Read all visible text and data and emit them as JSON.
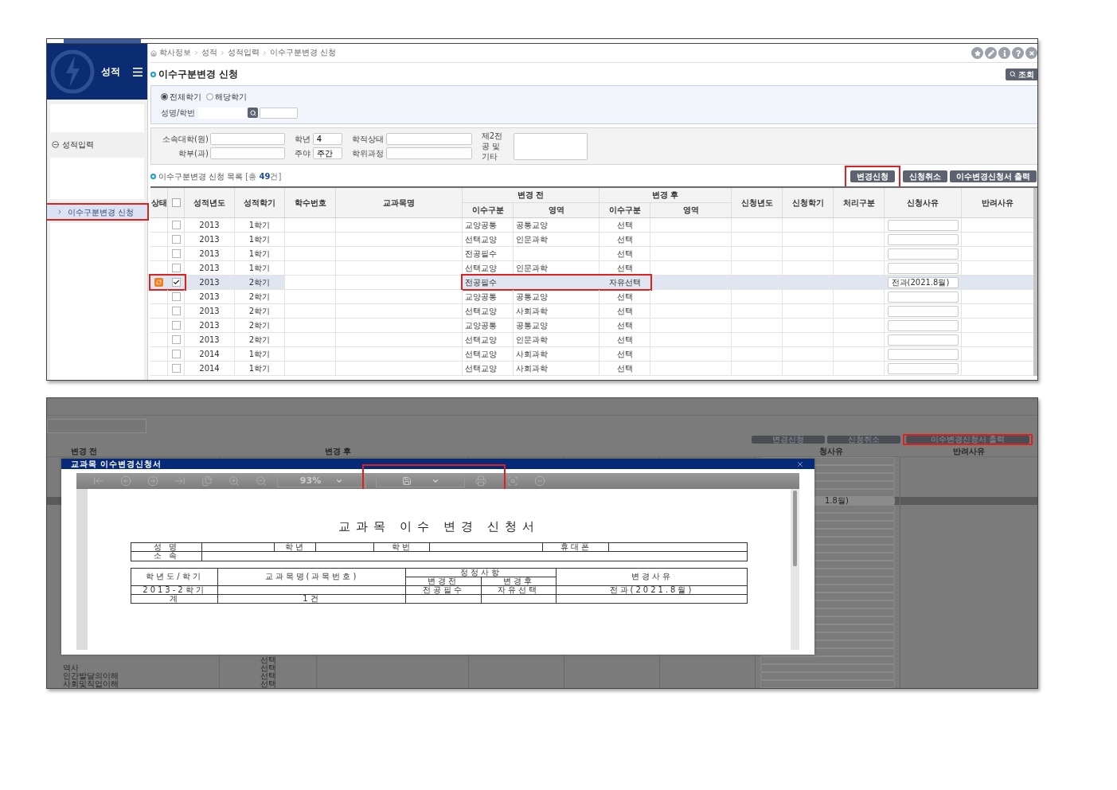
{
  "top_screen": {
    "sidebar": {
      "title": "성적",
      "groups": [
        {
          "label": "성적입력",
          "expanded": true
        }
      ],
      "items": [
        {
          "label": "이수구분변경 신청",
          "selected": true,
          "highlighted": true
        }
      ]
    },
    "breadcrumb": [
      "학사정보",
      "성적",
      "성적입력",
      "이수구분변경 신청"
    ],
    "page_title": "이수구분변경 신청",
    "query_button": "조회",
    "search": {
      "radios": [
        {
          "label": "전체학기",
          "selected": true
        },
        {
          "label": "해당학기",
          "selected": false
        }
      ],
      "name_label": "성명/학번"
    },
    "filters": {
      "college_label": "소속대학(원)",
      "dept_label": "학부(과)",
      "grade_label": "학년",
      "grade_value": "4",
      "shift_label": "주야",
      "shift_value": "주간",
      "status_label": "학적상태",
      "degree_label": "학위과정",
      "second_major_label": "제2전공 및 기타"
    },
    "list": {
      "title": "이수구분변경 신청 목록",
      "count_text": "[총 **49**건]"
    },
    "buttons": [
      {
        "label": "변경신청",
        "highlighted": true
      },
      {
        "label": "신청취소",
        "highlighted": false
      },
      {
        "label": "이수변경신청서 출력",
        "highlighted": false
      }
    ],
    "table": {
      "header": {
        "status": "상태",
        "all_checked": false,
        "year": "성적년도",
        "term": "성적학기",
        "code": "학수번호",
        "course": "교과목명",
        "before": {
          "label": "변경 전",
          "type": "이수구분",
          "area": "영역"
        },
        "after": {
          "label": "변경 후",
          "type": "이수구분",
          "area": "영역"
        },
        "apply_year": "신청년도",
        "apply_term": "신청학기",
        "process": "처리구분",
        "reason": "신청사유",
        "reject": "반려사유"
      },
      "rows": [
        {
          "year": "2013",
          "term": "1학기",
          "before_type": "교양공통",
          "before_area": "공통교양",
          "after_type": "선택",
          "checked": false,
          "selected": false,
          "flagged": false,
          "highlighted": false
        },
        {
          "year": "2013",
          "term": "1학기",
          "before_type": "선택교양",
          "before_area": "인문과학",
          "after_type": "선택",
          "checked": false,
          "selected": false,
          "flagged": false,
          "highlighted": false
        },
        {
          "year": "2013",
          "term": "1학기",
          "before_type": "전공필수",
          "after_type": "선택",
          "checked": false,
          "selected": false,
          "flagged": false,
          "highlighted": false
        },
        {
          "year": "2013",
          "term": "1학기",
          "before_type": "선택교양",
          "before_area": "인문과학",
          "after_type": "선택",
          "checked": false,
          "selected": false,
          "flagged": false,
          "highlighted": false
        },
        {
          "year": "2013",
          "term": "2학기",
          "before_type": "전공필수",
          "after_type": "자유선택",
          "reason": "전과(2021.8월)",
          "checked": true,
          "selected": true,
          "flagged": true,
          "highlighted": true
        },
        {
          "year": "2013",
          "term": "2학기",
          "before_type": "교양공통",
          "before_area": "공통교양",
          "after_type": "선택",
          "checked": false,
          "selected": false,
          "flagged": false,
          "highlighted": false
        },
        {
          "year": "2013",
          "term": "2학기",
          "before_type": "선택교양",
          "before_area": "사회과학",
          "after_type": "선택",
          "checked": false,
          "selected": false,
          "flagged": false,
          "highlighted": false
        },
        {
          "year": "2013",
          "term": "2학기",
          "before_type": "교양공통",
          "before_area": "공통교양",
          "after_type": "선택",
          "checked": false,
          "selected": false,
          "flagged": false,
          "highlighted": false
        },
        {
          "year": "2013",
          "term": "2학기",
          "before_type": "선택교양",
          "before_area": "인문과학",
          "after_type": "선택",
          "checked": false,
          "selected": false,
          "flagged": false,
          "highlighted": false
        },
        {
          "year": "2014",
          "term": "1학기",
          "before_type": "선택교양",
          "before_area": "사회과학",
          "after_type": "선택",
          "checked": false,
          "selected": false,
          "flagged": false,
          "highlighted": false
        },
        {
          "year": "2014",
          "term": "1학기",
          "before_type": "선택교양",
          "before_area": "사회과학",
          "after_type": "선택",
          "checked": false,
          "selected": false,
          "flagged": false,
          "highlighted": false
        }
      ]
    }
  },
  "bottom_screen": {
    "buttons": [
      {
        "label": "변경신청",
        "highlighted": false
      },
      {
        "label": "신청취소",
        "highlighted": false
      },
      {
        "label": "이수변경신청서 출력",
        "highlighted": true
      }
    ],
    "header": {
      "before": "변경 전",
      "after": "변경 후",
      "reason": "청사유",
      "reject": "반려사유"
    },
    "rows": [
      {
        "selected": false
      },
      {
        "selected": false
      },
      {
        "selected": false
      },
      {
        "selected": false
      },
      {
        "selected": false
      },
      {
        "selected": true,
        "reason": "1.8월)"
      },
      {
        "selected": false
      },
      {
        "selected": false
      },
      {
        "selected": false
      },
      {
        "selected": false
      },
      {
        "selected": false
      },
      {
        "selected": false
      },
      {
        "selected": false
      },
      {
        "selected": false
      },
      {
        "selected": false
      },
      {
        "selected": false
      },
      {
        "selected": false
      },
      {
        "selected": false
      },
      {
        "selected": false
      },
      {
        "selected": false
      },
      {
        "selected": false
      },
      {
        "selected": false
      },
      {
        "selected": false
      },
      {
        "selected": false
      },
      {
        "selected": false
      },
      {
        "selected": false,
        "type": "선택"
      },
      {
        "selected": false,
        "name": "역사",
        "type": "선택"
      },
      {
        "selected": false,
        "name": "인간발달의이해",
        "type": "선택"
      },
      {
        "selected": false,
        "name": "사회및직업이해",
        "type": "선택"
      }
    ],
    "dialog": {
      "title": "교과목 이수변경신청서",
      "toolbar": {
        "zoom": "93%",
        "save_print_highlighted": true
      },
      "document": {
        "title": "교과목 이수 변경 신청서",
        "info_labels": {
          "name": "성 명",
          "grade": "학년",
          "student_no": "학번",
          "phone": "휴대폰",
          "affiliation": "소 속"
        },
        "columns": {
          "term": "학년도/학기",
          "course": "교과목명(과목번호)",
          "correction": "정정사항",
          "before": "변경전",
          "after": "변경후",
          "reason": "변경사유"
        },
        "rows": [
          {
            "term": "2013-2학기",
            "before": "전공필수",
            "after": "자유선택",
            "reason": "전과(2021.8월)"
          }
        ],
        "total": {
          "label": "계",
          "count": "1건"
        }
      }
    }
  }
}
